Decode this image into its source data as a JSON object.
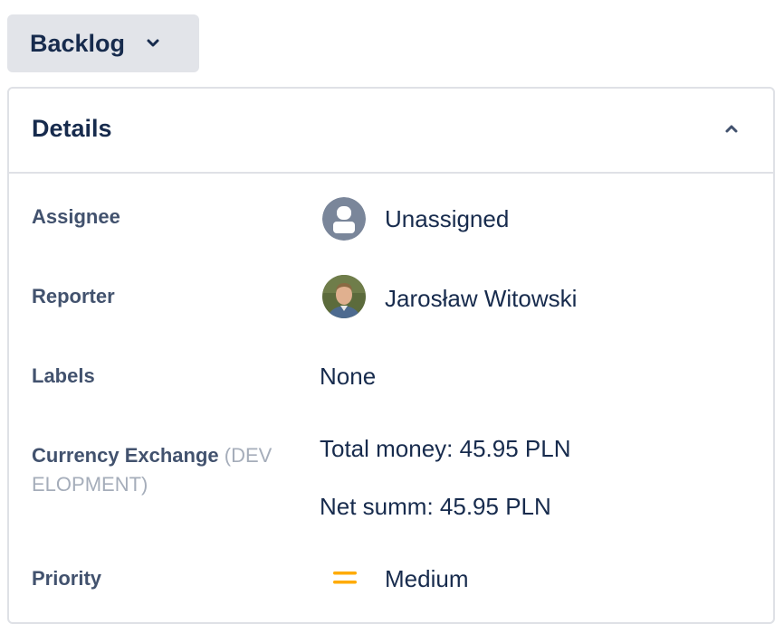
{
  "status": {
    "label": "Backlog",
    "icon": "chevron-down-icon"
  },
  "details": {
    "title": "Details",
    "collapse_icon": "chevron-up-icon",
    "fields": {
      "assignee": {
        "label": "Assignee",
        "value": "Unassigned",
        "icon": "default-user-avatar-icon"
      },
      "reporter": {
        "label": "Reporter",
        "value": "Jarosław Witowski",
        "icon": "user-photo-avatar"
      },
      "labels": {
        "label": "Labels",
        "value": "None"
      },
      "currency_exchange": {
        "label": "Currency Exchange",
        "sublabel": "(DEVELOPMENT)",
        "total_money": "Total money: 45.95 PLN",
        "net_summ": "Net summ: 45.95 PLN"
      },
      "priority": {
        "label": "Priority",
        "value": "Medium",
        "icon": "priority-medium-icon",
        "color": "#ffab00"
      }
    }
  }
}
